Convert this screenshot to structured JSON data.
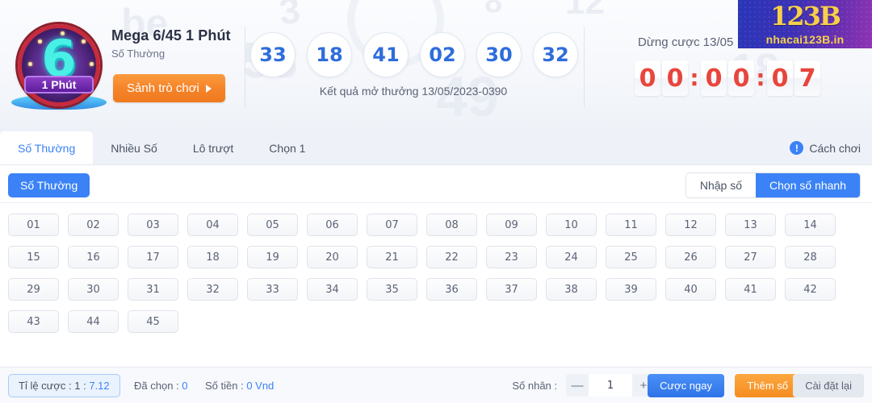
{
  "header": {
    "logo": {
      "number": "6",
      "label": "1 Phút"
    },
    "game_title": "Mega 6/45 1 Phút",
    "game_subtitle": "Số Thường",
    "lobby_button": "Sảnh trò chơi",
    "result_balls": [
      "33",
      "18",
      "41",
      "02",
      "30",
      "32"
    ],
    "result_text": "Kết quả mở thưởng 13/05/2023-0390",
    "stop_bet_text": "Dừng cược 13/05",
    "countdown": {
      "display": "00:00:07",
      "digits": [
        "0",
        "0",
        "0",
        "0",
        "0",
        "7"
      ],
      "separator": ":"
    },
    "brand": {
      "mark": "123B",
      "text": "nhacai123B.in"
    },
    "watermarks": [
      "be",
      "8",
      "12",
      "53",
      "49",
      "18",
      "3"
    ]
  },
  "tabs": [
    {
      "label": "Số Thường",
      "active": true
    },
    {
      "label": "Nhiều Số",
      "active": false
    },
    {
      "label": "Lô trượt",
      "active": false
    },
    {
      "label": "Chọn 1",
      "active": false
    }
  ],
  "how_to_play": {
    "label": "Cách chơi",
    "icon": "info-icon"
  },
  "toolbar": {
    "mode_pill": "Số Thường",
    "segments": [
      {
        "label": "Nhập số",
        "active": false
      },
      {
        "label": "Chọn số nhanh",
        "active": true
      }
    ]
  },
  "grid": {
    "rows": [
      [
        "01",
        "02",
        "03",
        "04",
        "05",
        "06",
        "07",
        "08",
        "09",
        "10",
        "11",
        "12",
        "13",
        "14"
      ],
      [
        "15",
        "16",
        "17",
        "18",
        "19",
        "20",
        "21",
        "22",
        "23",
        "24",
        "25",
        "26",
        "27",
        "28"
      ],
      [
        "29",
        "30",
        "31",
        "32",
        "33",
        "34",
        "35",
        "36",
        "37",
        "38",
        "39",
        "40",
        "41",
        "42"
      ],
      [
        "43",
        "44",
        "45"
      ]
    ]
  },
  "footer": {
    "odds_label": "Tỉ lệ cược : 1 : ",
    "odds_value": "7.12",
    "chosen_label": "Đã chọn : ",
    "chosen_value": "0",
    "amount_label": "Số tiền : ",
    "amount_value": "0 Vnd",
    "multiplier_label": "Số nhân :",
    "multiplier_value": "1",
    "minus": "—",
    "plus": "+",
    "bet_now": "Cược ngay",
    "add_number": "Thêm số",
    "reset": "Cài đặt lại"
  },
  "colors": {
    "accent_blue": "#3b82f6",
    "accent_orange": "#f58c20",
    "countdown_red": "#e8453c",
    "ball_blue": "#2f6ddb"
  }
}
